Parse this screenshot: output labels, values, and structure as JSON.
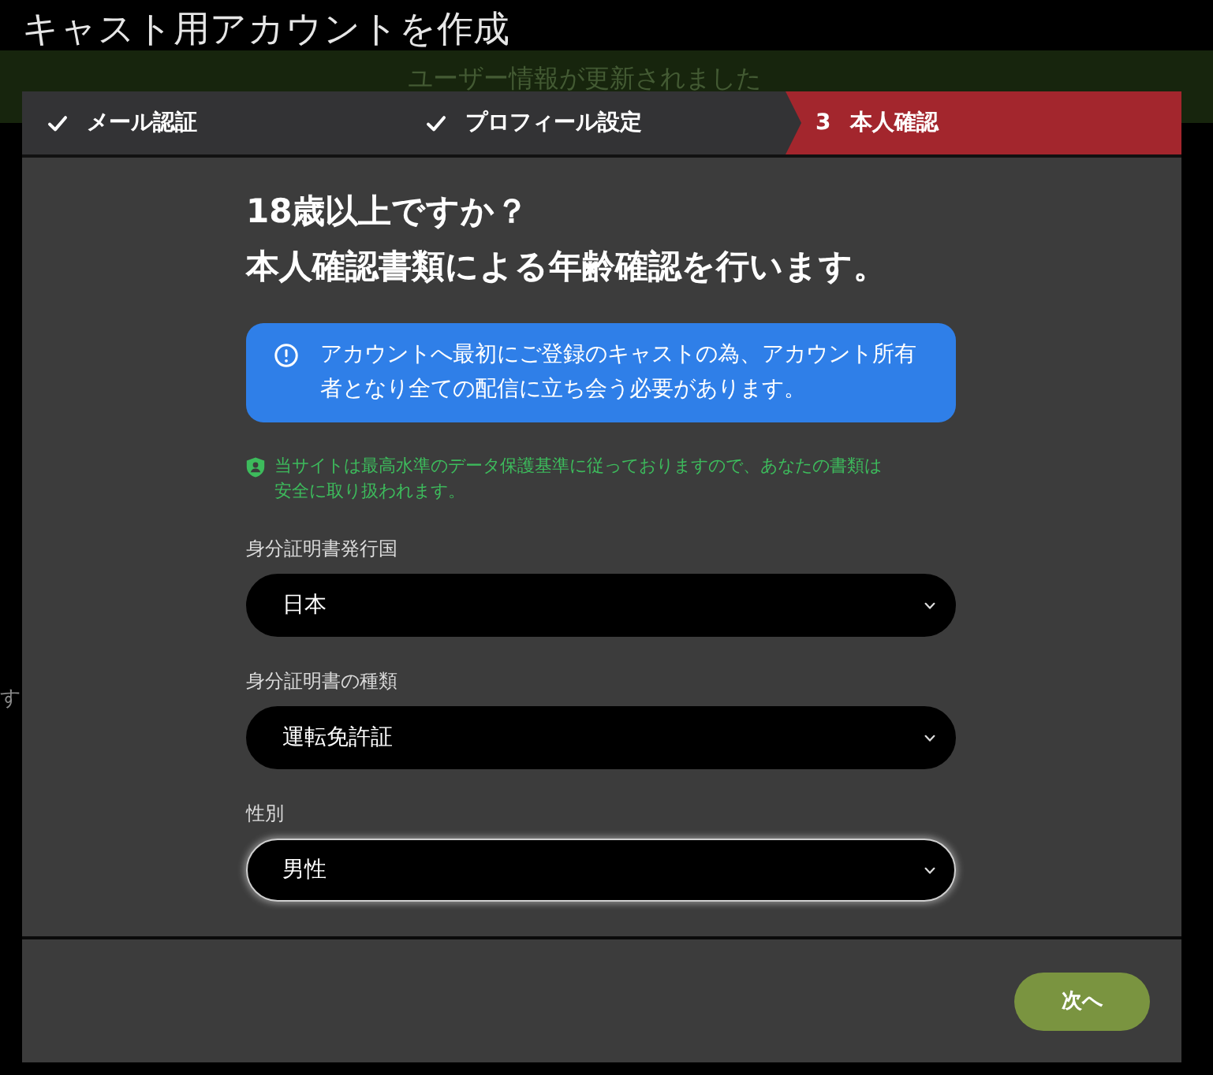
{
  "page": {
    "title": "キャスト用アカウントを作成",
    "banner": "ユーザー情報が更新されました",
    "background_text": "す"
  },
  "steps": [
    {
      "label": "メール認証",
      "done": true,
      "selected": false
    },
    {
      "label": "プロフィール設定",
      "done": true,
      "selected": false
    },
    {
      "label": "本人確認",
      "number": "3",
      "done": false,
      "selected": true
    }
  ],
  "heading_lines": [
    "18歳以上ですか？",
    "本人確認書類による年齢確認を行います。"
  ],
  "alert": {
    "text": "アカウントへ最初にご登録のキャストの為、アカウント所有者となり全ての配信に立ち会う必要があります。"
  },
  "security_note": "当サイトは最高水準のデータ保護基準に従っておりますので、あなたの書類は安全に取り扱われます。",
  "fields": [
    {
      "label": "身分証明書発行国",
      "value": "日本",
      "focused": false
    },
    {
      "label": "身分証明書の種類",
      "value": "運転免許証",
      "focused": false
    },
    {
      "label": "性別",
      "value": "男性",
      "focused": true
    }
  ],
  "next_button": {
    "label": "次へ"
  }
}
